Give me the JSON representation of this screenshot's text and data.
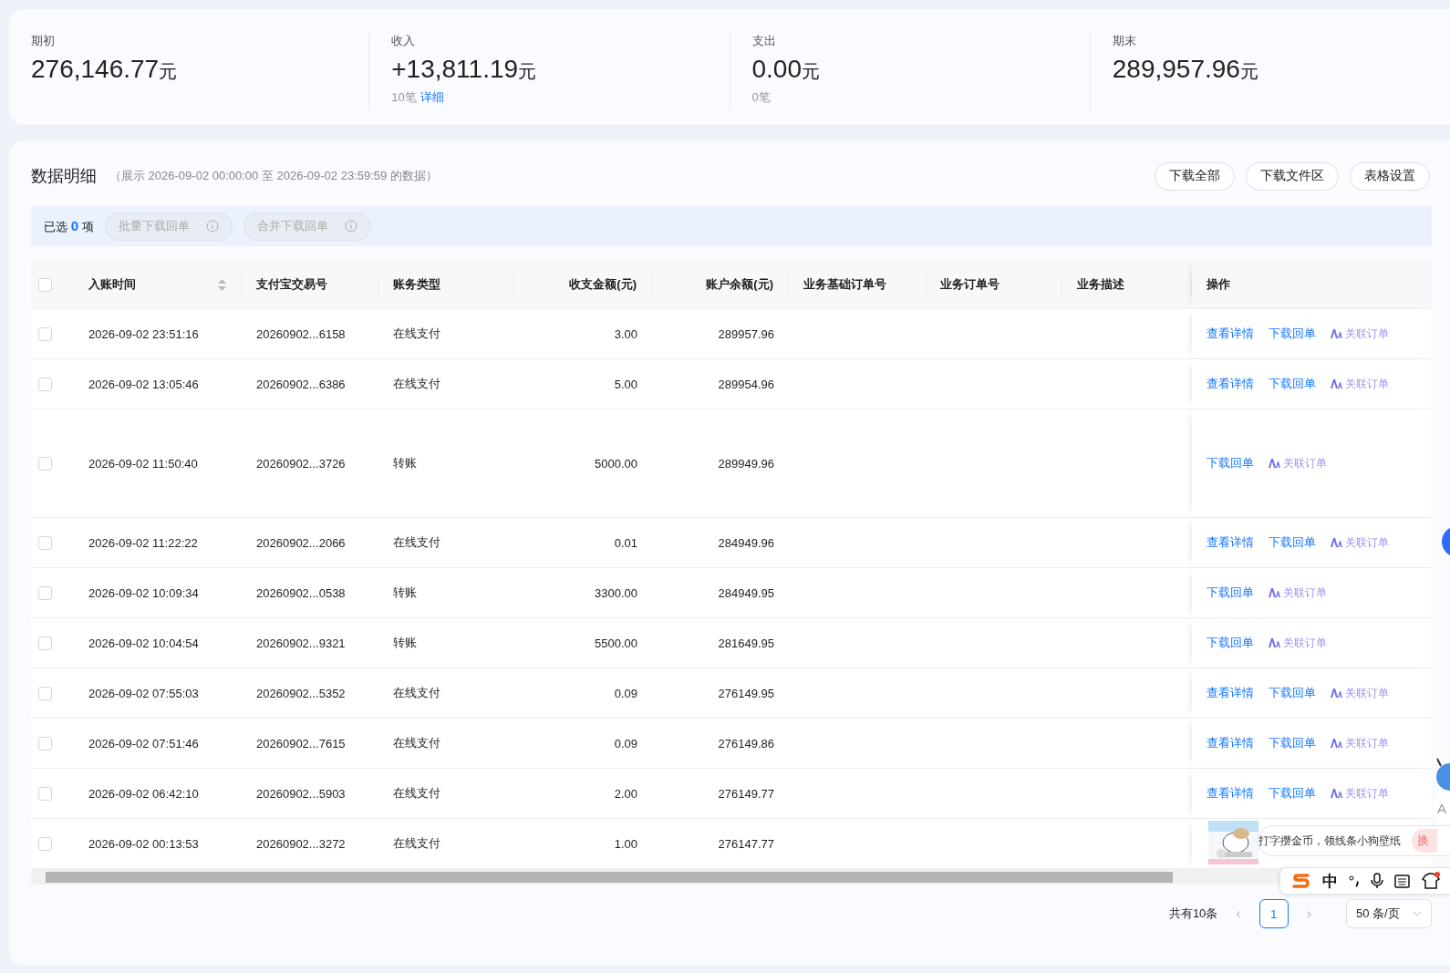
{
  "summary": [
    {
      "label": "期初",
      "amount": "276,146.77",
      "unit": "元"
    },
    {
      "label": "收入",
      "amount": "+13,811.19",
      "unit": "元",
      "count": "10笔",
      "link": "详细"
    },
    {
      "label": "支出",
      "amount": "0.00",
      "unit": "元",
      "count": "0笔"
    },
    {
      "label": "期末",
      "amount": "289,957.96",
      "unit": "元"
    }
  ],
  "detail": {
    "title": "数据明细",
    "subtitle": "（展示 2026-09-02 00:00:00 至 2026-09-02 23:59:59 的数据）",
    "buttons": [
      "下载全部",
      "下载文件区",
      "表格设置"
    ]
  },
  "selection": {
    "prefix": "已选",
    "count": "0",
    "suffix": "项",
    "buttons": [
      {
        "label": "批量下载回单",
        "disabled": true
      },
      {
        "label": "合并下载回单",
        "disabled": true
      }
    ]
  },
  "table": {
    "all_checked": false,
    "columns": [
      {
        "label": "入账时间",
        "sortable": true
      },
      {
        "label": "支付宝交易号",
        "sortable": false
      },
      {
        "label": "账务类型",
        "sortable": false
      },
      {
        "label": "收支金额(元)",
        "sortable": false
      },
      {
        "label": "账户余额(元)",
        "sortable": false
      },
      {
        "label": "业务基础订单号",
        "sortable": false
      },
      {
        "label": "业务订单号",
        "sortable": false
      },
      {
        "label": "业务描述",
        "sortable": false
      },
      {
        "label": "操作",
        "sortable": false
      }
    ],
    "rows": [
      {
        "checked": false,
        "tall": false,
        "cells": [
          "2026-09-02 23:51:16",
          "20260902...6158",
          "在线支付",
          "3.00",
          "289957.96"
        ],
        "actions": [
          {
            "label": "查看详情",
            "kind": "link"
          },
          {
            "label": "下载回单",
            "kind": "link"
          },
          {
            "label": "关联订单",
            "kind": "ai"
          }
        ]
      },
      {
        "checked": false,
        "tall": false,
        "cells": [
          "2026-09-02 13:05:46",
          "20260902...6386",
          "在线支付",
          "5.00",
          "289954.96"
        ],
        "actions": [
          {
            "label": "查看详情",
            "kind": "link"
          },
          {
            "label": "下载回单",
            "kind": "link"
          },
          {
            "label": "关联订单",
            "kind": "ai"
          }
        ]
      },
      {
        "checked": false,
        "tall": true,
        "cells": [
          "2026-09-02 11:50:40",
          "20260902...3726",
          "转账",
          "5000.00",
          "289949.96"
        ],
        "actions": [
          {
            "label": "下载回单",
            "kind": "link"
          },
          {
            "label": "关联订单",
            "kind": "ai"
          }
        ]
      },
      {
        "checked": false,
        "tall": false,
        "cells": [
          "2026-09-02 11:22:22",
          "20260902...2066",
          "在线支付",
          "0.01",
          "284949.96"
        ],
        "actions": [
          {
            "label": "查看详情",
            "kind": "link"
          },
          {
            "label": "下载回单",
            "kind": "link"
          },
          {
            "label": "关联订单",
            "kind": "ai"
          }
        ]
      },
      {
        "checked": false,
        "tall": false,
        "cells": [
          "2026-09-02 10:09:34",
          "20260902...0538",
          "转账",
          "3300.00",
          "284949.95"
        ],
        "actions": [
          {
            "label": "下载回单",
            "kind": "link"
          },
          {
            "label": "关联订单",
            "kind": "ai"
          }
        ]
      },
      {
        "checked": false,
        "tall": false,
        "cells": [
          "2026-09-02 10:04:54",
          "20260902...9321",
          "转账",
          "5500.00",
          "281649.95"
        ],
        "actions": [
          {
            "label": "下载回单",
            "kind": "link"
          },
          {
            "label": "关联订单",
            "kind": "ai"
          }
        ]
      },
      {
        "checked": false,
        "tall": false,
        "cells": [
          "2026-09-02 07:55:03",
          "20260902...5352",
          "在线支付",
          "0.09",
          "276149.95"
        ],
        "actions": [
          {
            "label": "查看详情",
            "kind": "link"
          },
          {
            "label": "下载回单",
            "kind": "link"
          },
          {
            "label": "关联订单",
            "kind": "ai"
          }
        ]
      },
      {
        "checked": false,
        "tall": false,
        "cells": [
          "2026-09-02 07:51:46",
          "20260902...7615",
          "在线支付",
          "0.09",
          "276149.86"
        ],
        "actions": [
          {
            "label": "查看详情",
            "kind": "link"
          },
          {
            "label": "下载回单",
            "kind": "link"
          },
          {
            "label": "关联订单",
            "kind": "ai"
          }
        ]
      },
      {
        "checked": false,
        "tall": false,
        "cells": [
          "2026-09-02 06:42:10",
          "20260902...5903",
          "在线支付",
          "2.00",
          "276149.77"
        ],
        "actions": [
          {
            "label": "查看详情",
            "kind": "link"
          },
          {
            "label": "下载回单",
            "kind": "link"
          },
          {
            "label": "关联订单",
            "kind": "ai"
          }
        ]
      },
      {
        "checked": false,
        "tall": false,
        "cells": [
          "2026-09-02 00:13:53",
          "20260902...3272",
          "在线支付",
          "1.00",
          "276147.77"
        ],
        "actions": []
      }
    ]
  },
  "pagination": {
    "total": "共有10条",
    "prev": "‹",
    "pages": [
      {
        "label": "1",
        "selected": true
      }
    ],
    "next": "›",
    "page_size": "50 条/页"
  },
  "popup": {
    "text": "打字攒金币，领线条小狗壁纸",
    "button": "换"
  },
  "side_panel": {
    "text": "A"
  },
  "ime": {
    "mode": "中"
  }
}
